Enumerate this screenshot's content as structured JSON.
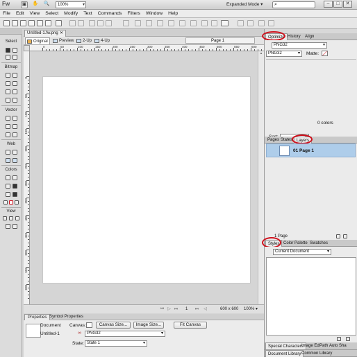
{
  "titlebar": {
    "app_icon": "Fw",
    "zoom_value": "100%",
    "workspace": "Expanded Mode",
    "minimize": "–",
    "maximize": "□",
    "close": "✕"
  },
  "menu": [
    "File",
    "Edit",
    "View",
    "Select",
    "Modify",
    "Text",
    "Commands",
    "Filters",
    "Window",
    "Help"
  ],
  "document": {
    "tab_title": "Untitled-1.fw.png",
    "tab_close": "✕",
    "page_name": "Page 1",
    "canvas_size": "600 x 600",
    "zoom": "100%",
    "page_index": "1"
  },
  "views": {
    "original": "Original",
    "preview": "Preview",
    "two_up": "2-Up",
    "four_up": "4-Up"
  },
  "rulers": {
    "h": [
      "0",
      "50",
      "100",
      "150",
      "200",
      "250",
      "300",
      "350",
      "400",
      "450",
      "500",
      "550",
      "600",
      "650"
    ],
    "v": [
      "0",
      "50",
      "100",
      "150",
      "200",
      "250",
      "300",
      "350",
      "400",
      "450",
      "500",
      "550",
      "600",
      "650"
    ]
  },
  "tools": {
    "select": "Select",
    "bitmap": "Bitmap",
    "vector": "Vector",
    "web": "Web",
    "colors": "Colors",
    "view": "View"
  },
  "properties": {
    "tab1": "Properties",
    "tab2": "Symbol Properties",
    "doc_label": "Document",
    "doc_name": "Untitled-1",
    "canvas_label": "Canvas:",
    "canvas_size_btn": "Canvas Size...",
    "image_size_btn": "Image Size...",
    "fit_canvas_btn": "Fit Canvas",
    "format": "PNG32",
    "state_label": "State:",
    "state_value": "State 1"
  },
  "optimize": {
    "tab_optimize": "Optimize",
    "tab_history": "History",
    "tab_align": "Align",
    "preset": "PNG32",
    "format": "PNG32",
    "matte_label": "Matte:",
    "colors_count": "0 colors",
    "sort_label": "Sort:"
  },
  "pages": {
    "tab_pages": "Pages",
    "tab_states": "States",
    "tab_layers": "Layers",
    "page_row": "01  Page 1",
    "footer": "1 Page"
  },
  "styles": {
    "tab_styles": "Styles",
    "tab_palette": "Color Palette",
    "tab_swatches": "Swatches",
    "source": "Current Document"
  },
  "bottom_tabs": {
    "special": "Special Characters",
    "image_ed": "Image Ed",
    "path": "Path",
    "autoshape": "Auto Sha",
    "doc_library": "Document Library",
    "common_library": "Common Library"
  },
  "colors": {
    "highlight": "#d0101c",
    "selection": "#aecdea"
  }
}
